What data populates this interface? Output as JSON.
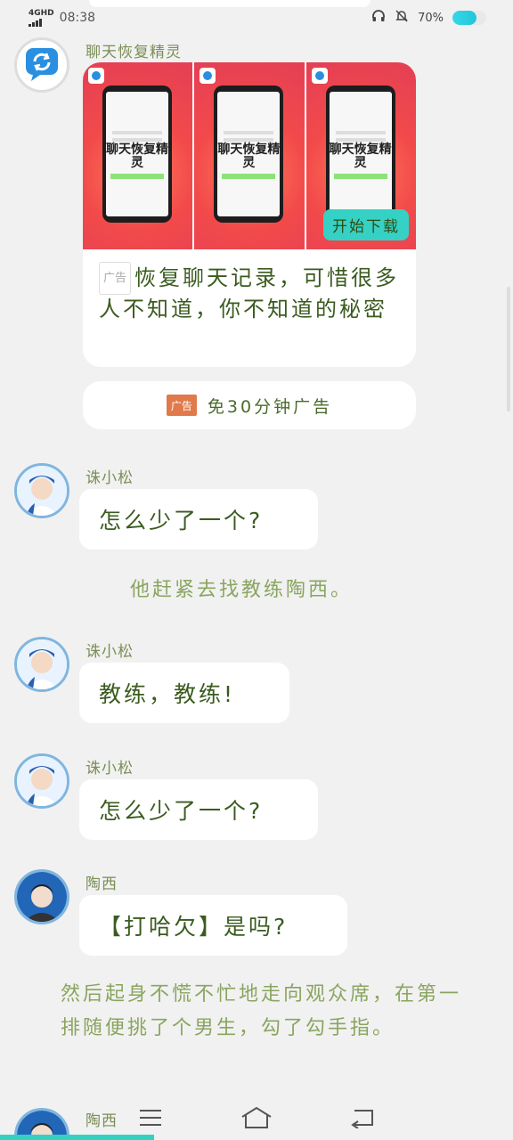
{
  "status_bar": {
    "network": "4GHD",
    "time": "08:38",
    "battery_pct": "70%",
    "battery_level": 0.7
  },
  "ad": {
    "sender_name": "聊天恢复精灵",
    "panel_title": "聊天恢复精灵",
    "download_label": "开始下载",
    "badge_label": "广告",
    "text": "恢复聊天记录，可惜很多人不知道，你不知道的秘密",
    "free_icon_label": "广告",
    "free_label": "免30分钟广告"
  },
  "messages": [
    {
      "name": "诛小松",
      "text": "怎么少了一个?"
    },
    {
      "narration": "他赶紧去找教练陶西。"
    },
    {
      "name": "诛小松",
      "text": "教练，教练!"
    },
    {
      "name": "诛小松",
      "text": "怎么少了一个?"
    },
    {
      "name": "陶西",
      "text": "【打哈欠】是吗?"
    },
    {
      "narration": "然后起身不慌不忙地走向观众席，在第一排随便挑了个男生，勾了勾手指。"
    },
    {
      "name": "陶西"
    }
  ],
  "progress_level": 0.3,
  "colors": {
    "accent": "#31d2c2",
    "avatar_border": "#7fb6df",
    "text_green": "#3b5b1f"
  },
  "icons": [
    "headphones-icon",
    "mute-bell-icon",
    "battery-icon",
    "menu-icon",
    "home-icon",
    "back-icon",
    "refresh-chat-icon"
  ]
}
